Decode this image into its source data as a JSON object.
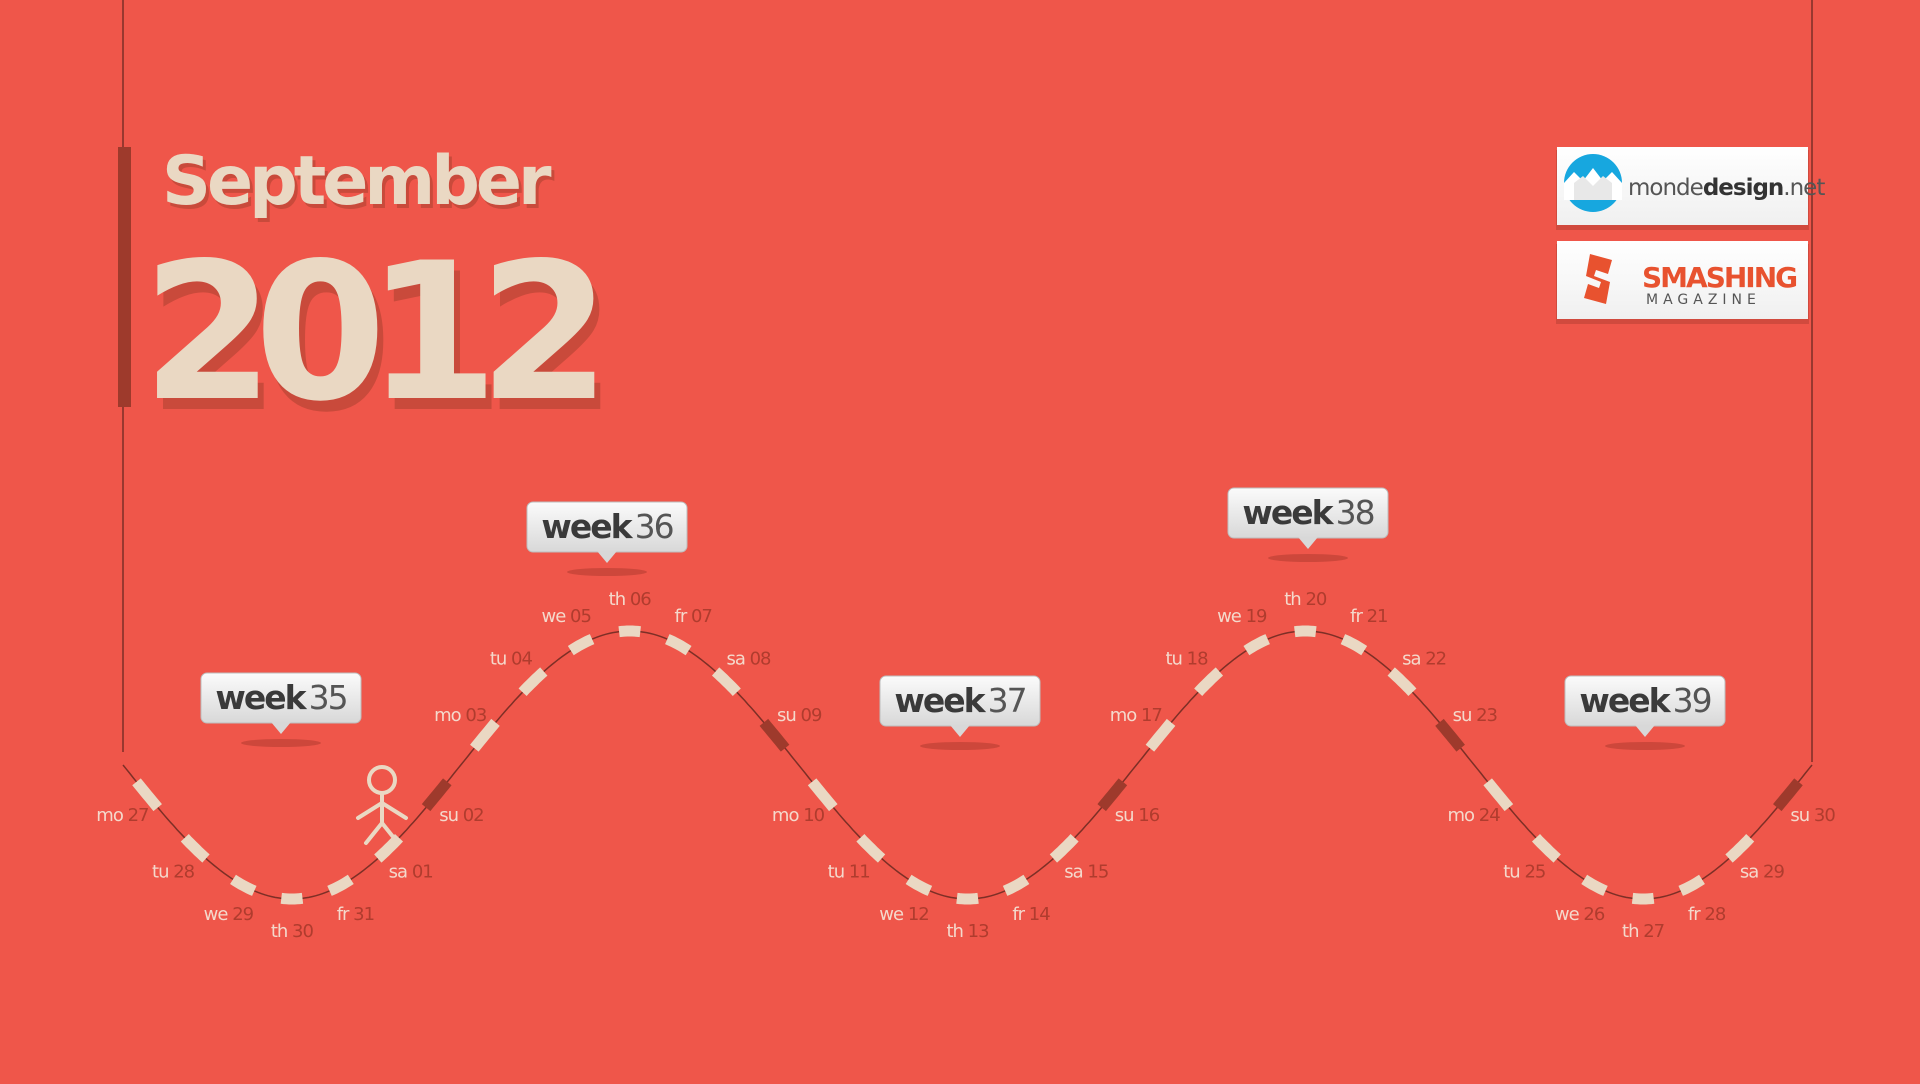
{
  "colors": {
    "background": "#ef564a",
    "cream": "#ead8c3",
    "cream_shadow": "#c94a3b",
    "dark_accent": "#9e3a2c",
    "day_number": "#b03c2e",
    "day_abbrev": "#f4d9cc",
    "curve_line": "#7d2f26"
  },
  "header": {
    "month": "September",
    "year": "2012"
  },
  "logos": {
    "monde": {
      "name_light": "monde",
      "name_bold": "design",
      "name_suffix": ".net"
    },
    "smashing": {
      "title": "SMASHING",
      "subtitle": "MAGAZINE"
    }
  },
  "week_labels": [
    {
      "word": "week",
      "number": "35"
    },
    {
      "word": "week",
      "number": "36"
    },
    {
      "word": "week",
      "number": "37"
    },
    {
      "word": "week",
      "number": "38"
    },
    {
      "word": "week",
      "number": "39"
    }
  ],
  "days": [
    {
      "abbr": "mo",
      "num": "27",
      "sunday": false
    },
    {
      "abbr": "tu",
      "num": "28",
      "sunday": false
    },
    {
      "abbr": "we",
      "num": "29",
      "sunday": false
    },
    {
      "abbr": "th",
      "num": "30",
      "sunday": false
    },
    {
      "abbr": "fr",
      "num": "31",
      "sunday": false
    },
    {
      "abbr": "sa",
      "num": "01",
      "sunday": false
    },
    {
      "abbr": "su",
      "num": "02",
      "sunday": true
    },
    {
      "abbr": "mo",
      "num": "03",
      "sunday": false
    },
    {
      "abbr": "tu",
      "num": "04",
      "sunday": false
    },
    {
      "abbr": "we",
      "num": "05",
      "sunday": false
    },
    {
      "abbr": "th",
      "num": "06",
      "sunday": false
    },
    {
      "abbr": "fr",
      "num": "07",
      "sunday": false
    },
    {
      "abbr": "sa",
      "num": "08",
      "sunday": false
    },
    {
      "abbr": "su",
      "num": "09",
      "sunday": true
    },
    {
      "abbr": "mo",
      "num": "10",
      "sunday": false
    },
    {
      "abbr": "tu",
      "num": "11",
      "sunday": false
    },
    {
      "abbr": "we",
      "num": "12",
      "sunday": false
    },
    {
      "abbr": "th",
      "num": "13",
      "sunday": false
    },
    {
      "abbr": "fr",
      "num": "14",
      "sunday": false
    },
    {
      "abbr": "sa",
      "num": "15",
      "sunday": false
    },
    {
      "abbr": "su",
      "num": "16",
      "sunday": true
    },
    {
      "abbr": "mo",
      "num": "17",
      "sunday": false
    },
    {
      "abbr": "tu",
      "num": "18",
      "sunday": false
    },
    {
      "abbr": "we",
      "num": "19",
      "sunday": false
    },
    {
      "abbr": "th",
      "num": "20",
      "sunday": false
    },
    {
      "abbr": "fr",
      "num": "21",
      "sunday": false
    },
    {
      "abbr": "sa",
      "num": "22",
      "sunday": false
    },
    {
      "abbr": "su",
      "num": "23",
      "sunday": true
    },
    {
      "abbr": "mo",
      "num": "24",
      "sunday": false
    },
    {
      "abbr": "tu",
      "num": "25",
      "sunday": false
    },
    {
      "abbr": "we",
      "num": "26",
      "sunday": false
    },
    {
      "abbr": "th",
      "num": "27",
      "sunday": false
    },
    {
      "abbr": "fr",
      "num": "28",
      "sunday": false
    },
    {
      "abbr": "sa",
      "num": "29",
      "sunday": false
    },
    {
      "abbr": "su",
      "num": "30",
      "sunday": true
    }
  ],
  "icons": {
    "figure": "stick-figure-icon"
  }
}
